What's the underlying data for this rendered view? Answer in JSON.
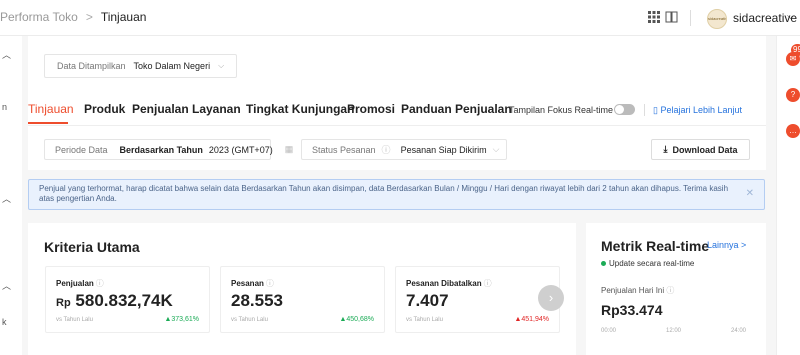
{
  "breadcrumb": {
    "parent": "Performa Toko",
    "separator": ">",
    "current": "Tinjauan"
  },
  "topbar": {
    "username": "sidacreative",
    "avatar_text": "sidacreative"
  },
  "left_strip": {
    "items": [
      "n",
      "k"
    ]
  },
  "right_strip": {
    "badge": "99"
  },
  "data_select": {
    "label": "Data Ditampilkan",
    "value": "Toko Dalam Negeri"
  },
  "tabs": [
    {
      "label": "Tinjauan",
      "active": true
    },
    {
      "label": "Produk"
    },
    {
      "label": "Penjualan"
    },
    {
      "label": "Layanan"
    },
    {
      "label": "Tingkat Kunjungan"
    },
    {
      "label": "Promosi"
    },
    {
      "label": "Panduan Penjualan"
    }
  ],
  "realtime_focus": {
    "label": "Tampilan Fokus Real-time",
    "enabled": false
  },
  "learn_more": "Pelajari Lebih Lanjut",
  "filters": {
    "period": {
      "label": "Periode Data",
      "mode": "Berdasarkan Tahun",
      "value": "2023 (GMT+07)"
    },
    "status": {
      "label": "Status Pesanan",
      "value": "Pesanan Siap Dikirim"
    },
    "download_label": "Download Data"
  },
  "notice": {
    "text": "Penjual yang terhormat, harap dicatat bahwa selain data Berdasarkan Tahun akan disimpan, data Berdasarkan Bulan / Minggu / Hari dengan riwayat lebih dari 2 tahun akan dihapus. Terima kasih atas pengertian Anda."
  },
  "main_criteria": {
    "title": "Kriteria Utama",
    "metrics": [
      {
        "label": "Penjualan",
        "prefix": "Rp",
        "value": "580.832,74K",
        "compare_label": "vs Tahun Lalu",
        "change": "▲373,61%",
        "trend": "up"
      },
      {
        "label": "Pesanan",
        "prefix": "",
        "value": "28.553",
        "compare_label": "vs Tahun Lalu",
        "change": "▲450,68%",
        "trend": "up"
      },
      {
        "label": "Pesanan Dibatalkan",
        "prefix": "",
        "value": "7.407",
        "compare_label": "vs Tahun Lalu",
        "change": "▲451,94%",
        "trend": "down"
      }
    ]
  },
  "realtime": {
    "title": "Metrik Real-time",
    "more": "Lainnya >",
    "update_text": "Update secara real-time",
    "sales_label": "Penjualan Hari Ini",
    "sales_value": "Rp33.474",
    "times": [
      "00:00",
      "12:00",
      "24:00"
    ]
  },
  "colors": {
    "accent": "#ee4d2d",
    "link": "#2673dd",
    "up": "#1bab56",
    "down": "#e12626"
  }
}
